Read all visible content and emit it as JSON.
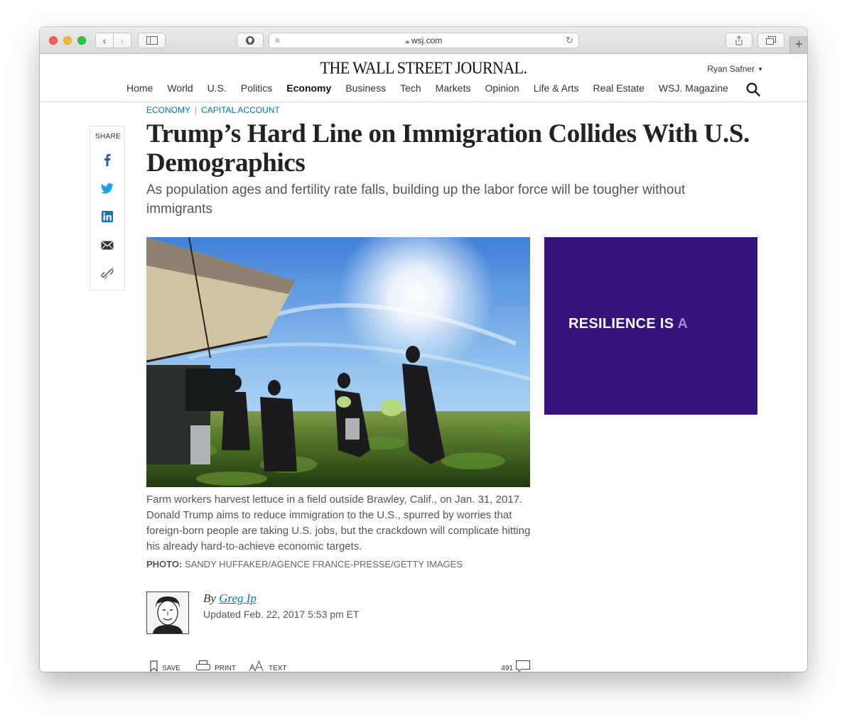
{
  "browser": {
    "url": "wsj.com",
    "new_tab_label": "+"
  },
  "site": {
    "logo": "THE WALL STREET JOURNAL.",
    "user_name": "Ryan Safner",
    "nav": [
      "Home",
      "World",
      "U.S.",
      "Politics",
      "Economy",
      "Business",
      "Tech",
      "Markets",
      "Opinion",
      "Life & Arts",
      "Real Estate",
      "WSJ. Magazine"
    ],
    "nav_active": "Economy"
  },
  "share": {
    "label": "SHARE",
    "icons": [
      "facebook-icon",
      "twitter-icon",
      "linkedin-icon",
      "email-icon",
      "link-icon"
    ]
  },
  "article": {
    "section": "ECONOMY",
    "column": "CAPITAL ACCOUNT",
    "headline": "Trump’s Hard Line on Immigration Collides With U.S. Demographics",
    "dek": "As population ages and fertility rate falls, building up the labor force will be tougher without immigrants",
    "caption": "Farm workers harvest lettuce in a field outside Brawley, Calif., on Jan. 31, 2017. Donald Trump aims to reduce immigration to the U.S., spurred by worries that foreign-born people are taking U.S. jobs, but the crackdown will complicate hitting his already hard-to-achieve economic targets.",
    "credit_label": "PHOTO:",
    "credit": "SANDY HUFFAKER/AGENCE FRANCE-PRESSE/GETTY IMAGES",
    "byline_prefix": "By",
    "author": "Greg Ip",
    "updated": "Updated Feb. 22, 2017 5:53 pm ET"
  },
  "ad": {
    "text_main": "RESILIENCE IS",
    "text_faint": "A",
    "color": "#35117b"
  },
  "tools": {
    "save": "SAVE",
    "print": "PRINT",
    "text": "TEXT",
    "comment_count": "491"
  },
  "colors": {
    "link_blue": "#0274b6"
  }
}
